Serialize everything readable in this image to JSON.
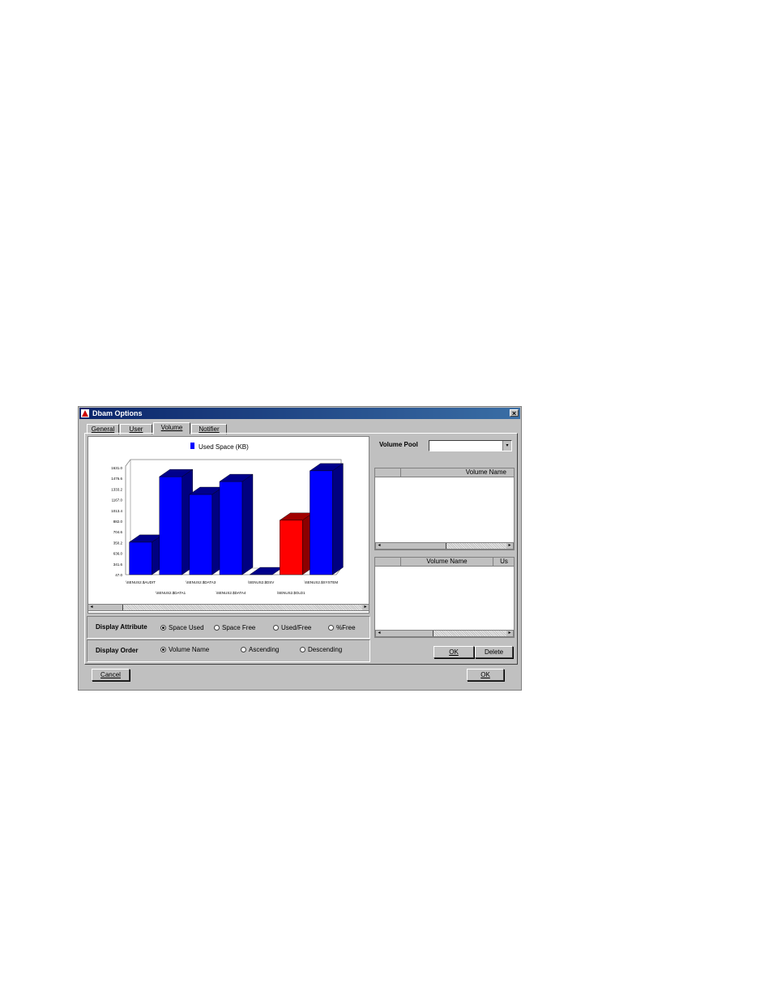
{
  "window": {
    "title": "Dbam Options"
  },
  "tabs": [
    {
      "label": "General"
    },
    {
      "label": "User"
    },
    {
      "label": "Volume",
      "active": true
    },
    {
      "label": "Notifier"
    }
  ],
  "volume_pool": {
    "label": "Volume Pool",
    "value": ""
  },
  "list1": {
    "headers": [
      "",
      "Volume Name"
    ]
  },
  "list2": {
    "headers": [
      "",
      "Volume Name",
      "Us"
    ]
  },
  "display_attribute": {
    "label": "Display Attribute",
    "options": [
      "Space Used",
      "Space Free",
      "Used/Free",
      "%Free"
    ],
    "selected": "Space Used"
  },
  "display_order": {
    "label": "Display Order",
    "options": [
      "Volume Name",
      "Ascending",
      "Descending"
    ],
    "selected": "Volume Name"
  },
  "buttons": {
    "ok_small": "OK",
    "delete": "Delete",
    "cancel": "Cancel",
    "ok": "OK"
  },
  "colors": {
    "bar": "#0000ff",
    "bar_highlight": "#ff0000"
  },
  "chart_data": {
    "type": "bar",
    "legend": [
      {
        "name": "Used Space (KB)",
        "color": "#0000ff"
      }
    ],
    "categories": [
      "\\SENUS2.$AUDIT",
      "\\SENUS2.$DATA1",
      "\\SENUS2.$DATA3",
      "\\SENUS2.$DATA4",
      "\\SENUS2.$DSV",
      "\\SENUS2.$OLD1",
      "\\SENUS2.$SYSTEM"
    ],
    "values": [
      652,
      1870,
      1540,
      1780,
      47,
      1060,
      1980
    ],
    "highlight_index": 5,
    "yticks": [
      "47.0",
      "341.6",
      "636.0",
      "350.2",
      "704.6",
      "882.0",
      "1013.4",
      "1167.0",
      "1333.2",
      "1476.6",
      "1631.0"
    ],
    "ylim": [
      47,
      2068
    ]
  }
}
